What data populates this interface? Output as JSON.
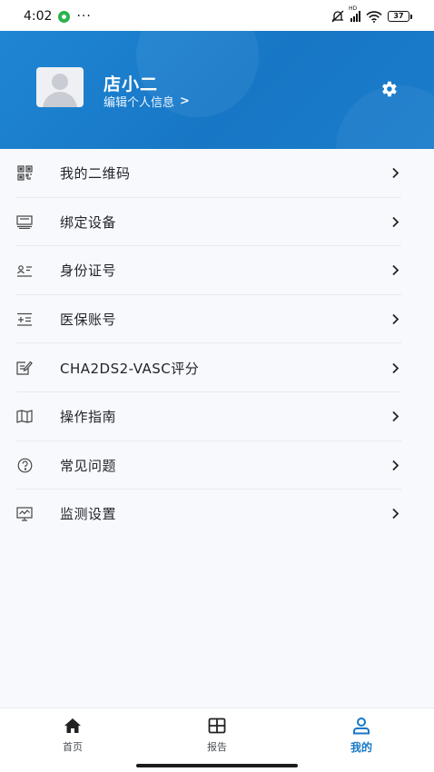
{
  "status_bar": {
    "time": "4:02",
    "more": "···",
    "network_badge": "HD",
    "battery_level": "37"
  },
  "profile": {
    "name": "店小二",
    "edit_label": "编辑个人信息",
    "edit_chevron": ">"
  },
  "menu": {
    "items": [
      {
        "label": "我的二维码",
        "icon": "qr-code-icon"
      },
      {
        "label": "绑定设备",
        "icon": "device-icon"
      },
      {
        "label": "身份证号",
        "icon": "id-card-icon"
      },
      {
        "label": "医保账号",
        "icon": "insurance-card-icon"
      },
      {
        "label": "CHA2DS2-VASC评分",
        "icon": "score-form-icon"
      },
      {
        "label": "操作指南",
        "icon": "guide-map-icon"
      },
      {
        "label": "常见问题",
        "icon": "question-icon"
      },
      {
        "label": "监测设置",
        "icon": "monitor-icon"
      }
    ],
    "chevron": ">"
  },
  "tabbar": {
    "tabs": [
      {
        "label": "首页",
        "icon": "home-icon",
        "active": false
      },
      {
        "label": "报告",
        "icon": "report-icon",
        "active": false
      },
      {
        "label": "我的",
        "icon": "profile-icon",
        "active": true
      }
    ]
  },
  "colors": {
    "primary": "#1777c6",
    "header_gradient_start": "#1f86d4",
    "background": "#f7f9fc",
    "text": "#1f2329"
  }
}
